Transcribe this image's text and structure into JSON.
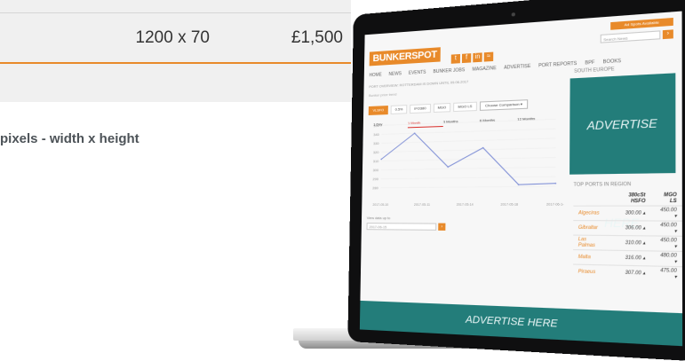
{
  "pricing": {
    "size": "1200 x 70",
    "price": "£1,500"
  },
  "footnote": "pixels - width x height",
  "site": {
    "top_link": "Ad Spots Available",
    "search_placeholder": "Search News",
    "search_button": "›",
    "logo": "BUNKERSPOT",
    "social_icons": [
      "twitter-icon",
      "facebook-icon",
      "linkedin-icon",
      "rss-icon"
    ],
    "social_glyphs": [
      "t",
      "f",
      "in",
      "≈"
    ],
    "nav": [
      "HOME",
      "NEWS",
      "EVENTS",
      "BUNKER JOBS",
      "MAGAZINE",
      "ADVERTISE",
      "PORT REPORTS",
      "BPF",
      "BOOKS"
    ],
    "region_label": "SOUTH EUROPE",
    "ad_side_text": "ADVERTISE HERE",
    "ticker_text": "PORT OVERVIEW: ROTTERDAM IS DOWN UNTIL 09.06.2017",
    "chart_title": "Bunker price trend",
    "grade_tabs": [
      "VLSFO",
      "0.5%",
      "IFO380",
      "MGO",
      "MGO LS"
    ],
    "compare_label": "Choose Comparison",
    "periods": [
      "1 Day",
      "1 Month",
      "3 Months",
      "6 Months",
      "12 Months"
    ],
    "view_label": "View data up to",
    "date_value": "2017-06-15",
    "date_button": "›",
    "ports_title": "TOP PORTS IN REGION",
    "ports_headers": [
      "",
      "380cSt HSFO",
      "MGO LS"
    ],
    "ports": [
      {
        "name": "Algeciras",
        "a": "300.00",
        "b": "450.00"
      },
      {
        "name": "Gibraltar",
        "a": "306.00",
        "b": "450.00"
      },
      {
        "name": "Las Palmas",
        "a": "310.00",
        "b": "450.00"
      },
      {
        "name": "Malta",
        "a": "316.00",
        "b": "480.00"
      },
      {
        "name": "Piraeus",
        "a": "307.00",
        "b": "475.00"
      }
    ],
    "ad_bottom_text": "ADVERTISE HERE"
  },
  "chart_data": {
    "type": "line",
    "x": [
      "2017-05-10",
      "2017-05-18",
      "2017-05-26",
      "2017-06-03",
      "2017-06-11",
      "2017-06-19"
    ],
    "y": [
      312,
      340,
      302,
      322,
      282,
      283
    ],
    "ylim": [
      270,
      350
    ],
    "yticks": [
      280,
      290,
      300,
      310,
      320,
      330,
      340,
      350
    ],
    "xticks": [
      "2017-05-10",
      "2017-05-11",
      "2017-05-14",
      "2017-05-18",
      "2017-06-14"
    ],
    "color": "#7f8fd6"
  },
  "colors": {
    "accent": "#e88a2a",
    "teal": "#237d7a",
    "active_period": "#d9302c"
  }
}
